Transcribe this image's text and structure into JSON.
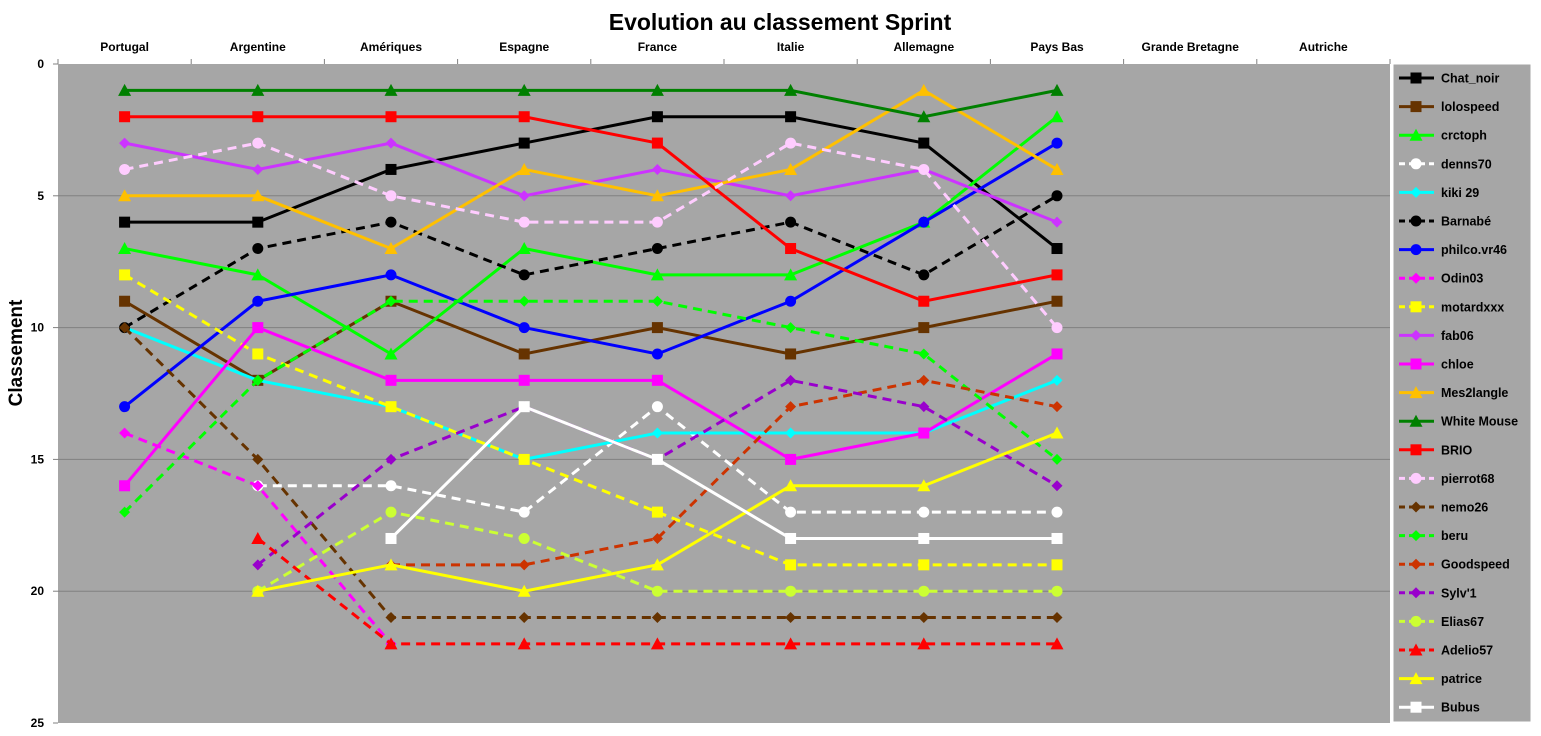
{
  "chart_data": {
    "type": "line",
    "title": "Evolution au classement Sprint",
    "ylabel": "Classement",
    "xlabel": "",
    "categories": [
      "Portugal",
      "Argentine",
      "Amériques",
      "Espagne",
      "France",
      "Italie",
      "Allemagne",
      "Pays Bas",
      "Grande Bretagne",
      "Autriche"
    ],
    "ylim": [
      0,
      25
    ],
    "y_reversed": true,
    "yticks": [
      0,
      5,
      10,
      15,
      20,
      25
    ],
    "grid": true,
    "legend_placement": "right",
    "plot_background": "#a6a6a6",
    "series": [
      {
        "name": "Chat_noir",
        "color": "#000000",
        "dash": false,
        "marker": "square",
        "values": [
          6,
          6,
          4,
          3,
          2,
          2,
          3,
          7,
          null,
          null
        ]
      },
      {
        "name": "lolospeed",
        "color": "#663300",
        "dash": false,
        "marker": "square",
        "values": [
          9,
          12,
          9,
          11,
          10,
          11,
          10,
          9,
          null,
          null
        ]
      },
      {
        "name": "crctoph",
        "color": "#00ff00",
        "dash": false,
        "marker": "triangle",
        "values": [
          7,
          8,
          11,
          7,
          8,
          8,
          6,
          2,
          null,
          null
        ]
      },
      {
        "name": "denns70",
        "color": "#ffffff",
        "dash": true,
        "marker": "circle",
        "values": [
          null,
          16,
          16,
          17,
          13,
          17,
          17,
          17,
          null,
          null
        ]
      },
      {
        "name": "kiki 29",
        "color": "#00ffff",
        "dash": false,
        "marker": "diamond",
        "values": [
          10,
          12,
          13,
          15,
          14,
          14,
          14,
          12,
          null,
          null
        ]
      },
      {
        "name": "Barnabé",
        "color": "#000000",
        "dash": true,
        "marker": "circle",
        "values": [
          10,
          7,
          6,
          8,
          7,
          6,
          8,
          5,
          null,
          null
        ]
      },
      {
        "name": "philco.vr46",
        "color": "#0000ff",
        "dash": false,
        "marker": "circle",
        "values": [
          13,
          9,
          8,
          10,
          11,
          9,
          6,
          3,
          null,
          null
        ]
      },
      {
        "name": "Odin03",
        "color": "#ff00ff",
        "dash": true,
        "marker": "diamond",
        "values": [
          14,
          16,
          22,
          null,
          null,
          null,
          null,
          null,
          null,
          null
        ]
      },
      {
        "name": "motardxxx",
        "color": "#ffff00",
        "dash": true,
        "marker": "square",
        "values": [
          8,
          11,
          13,
          15,
          17,
          19,
          19,
          19,
          null,
          null
        ]
      },
      {
        "name": "fab06",
        "color": "#cc33ff",
        "dash": false,
        "marker": "diamond",
        "values": [
          3,
          4,
          3,
          5,
          4,
          5,
          4,
          6,
          null,
          null
        ]
      },
      {
        "name": "chloe",
        "color": "#ff00ff",
        "dash": false,
        "marker": "square",
        "values": [
          16,
          10,
          12,
          12,
          12,
          15,
          14,
          11,
          null,
          null
        ]
      },
      {
        "name": "Mes2langle",
        "color": "#ffc000",
        "dash": false,
        "marker": "triangle",
        "values": [
          5,
          5,
          7,
          4,
          5,
          4,
          1,
          4,
          null,
          null
        ]
      },
      {
        "name": "White Mouse",
        "color": "#008000",
        "dash": false,
        "marker": "triangle",
        "values": [
          1,
          1,
          1,
          1,
          1,
          1,
          2,
          1,
          null,
          null
        ]
      },
      {
        "name": "BRIO",
        "color": "#ff0000",
        "dash": false,
        "marker": "square",
        "values": [
          2,
          2,
          2,
          2,
          3,
          7,
          9,
          8,
          null,
          null
        ]
      },
      {
        "name": "pierrot68",
        "color": "#ffccff",
        "dash": true,
        "marker": "circle",
        "values": [
          4,
          3,
          5,
          6,
          6,
          3,
          4,
          10,
          null,
          null
        ]
      },
      {
        "name": "nemo26",
        "color": "#663300",
        "dash": true,
        "marker": "diamond",
        "values": [
          10,
          15,
          21,
          21,
          21,
          21,
          21,
          21,
          null,
          null
        ]
      },
      {
        "name": "beru",
        "color": "#00ff00",
        "dash": true,
        "marker": "diamond",
        "values": [
          17,
          12,
          9,
          9,
          9,
          10,
          11,
          15,
          null,
          null
        ]
      },
      {
        "name": "Goodspeed",
        "color": "#cc3300",
        "dash": true,
        "marker": "diamond",
        "values": [
          null,
          null,
          19,
          19,
          18,
          13,
          12,
          13,
          null,
          null
        ]
      },
      {
        "name": "Sylv'1",
        "color": "#9900cc",
        "dash": true,
        "marker": "diamond",
        "values": [
          null,
          19,
          15,
          13,
          15,
          12,
          13,
          16,
          null,
          null
        ]
      },
      {
        "name": "Elias67",
        "color": "#ccff33",
        "dash": true,
        "marker": "circle",
        "values": [
          null,
          20,
          17,
          18,
          20,
          20,
          20,
          20,
          null,
          null
        ]
      },
      {
        "name": "Adelio57",
        "color": "#ff0000",
        "dash": true,
        "marker": "triangle",
        "values": [
          null,
          18,
          22,
          22,
          22,
          22,
          22,
          22,
          null,
          null
        ]
      },
      {
        "name": "patrice",
        "color": "#ffff00",
        "dash": false,
        "marker": "triangle",
        "values": [
          null,
          20,
          19,
          20,
          19,
          16,
          16,
          14,
          null,
          null
        ]
      },
      {
        "name": "Bubus",
        "color": "#ffffff",
        "dash": false,
        "marker": "square",
        "values": [
          null,
          null,
          18,
          13,
          15,
          18,
          18,
          18,
          null,
          null
        ]
      }
    ]
  }
}
